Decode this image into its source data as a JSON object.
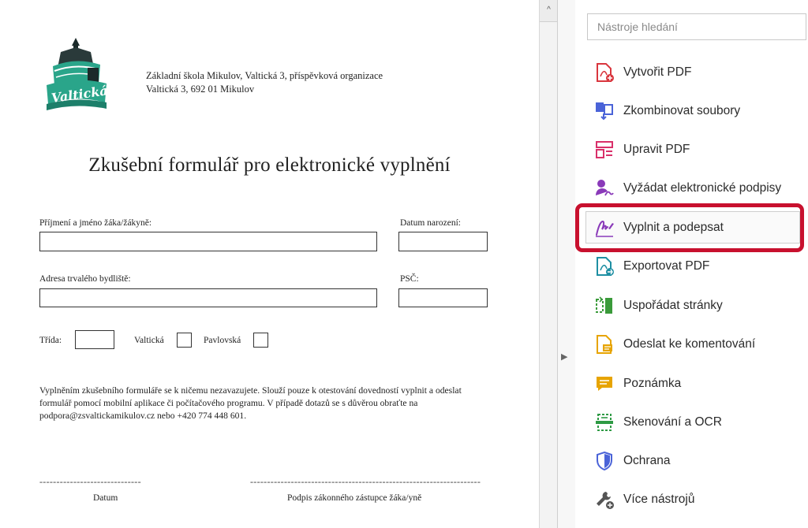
{
  "document": {
    "logo_text": "Valtická",
    "school_line1": "Základní škola Mikulov, Valtická 3, příspěvková organizace",
    "school_line2": "Valtická 3, 692 01 Mikulov",
    "form_title": "Zkušební formulář pro elektronické vyplnění",
    "fields": {
      "name_label": "Příjmení a jméno žáka/žákyně:",
      "birth_label": "Datum narození:",
      "address_label": "Adresa trvalého bydliště:",
      "psc_label": "PSČ:",
      "class_label": "Třída:",
      "valticka_label": "Valtická",
      "pavlovska_label": "Pavlovská"
    },
    "notice": "Vyplněním zkušebního formuláře se k ničemu nezavazujete. Slouží pouze k otestování dovedností vyplnit a odeslat formulář pomocí mobilní aplikace či počítačového programu. V případě dotazů se s důvěrou obraťte na podpora@zsvaltickamikulov.cz nebo +420 774 448 601.",
    "sig_dashes_left": "------------------------------",
    "sig_dashes_right": "--------------------------------------------------------------------",
    "date_label": "Datum",
    "signature_label": "Podpis zákonného zástupce žáka/yně"
  },
  "scrollbar": {
    "up_glyph": "^"
  },
  "divider": {
    "collapse_glyph": "▶"
  },
  "tools": {
    "search_placeholder": "Nástroje hledání",
    "items": [
      {
        "label": "Vytvořit PDF",
        "icon": "create-pdf-icon",
        "color": "#d9363e"
      },
      {
        "label": "Zkombinovat soubory",
        "icon": "combine-files-icon",
        "color": "#4a63d8"
      },
      {
        "label": "Upravit PDF",
        "icon": "edit-pdf-icon",
        "color": "#d9306a"
      },
      {
        "label": "Vyžádat elektronické podpisy",
        "icon": "request-signature-icon",
        "color": "#8a3ab9"
      },
      {
        "label": "Vyplnit a podepsat",
        "icon": "fill-sign-icon",
        "color": "#8a3ab9"
      },
      {
        "label": "Exportovat PDF",
        "icon": "export-pdf-icon",
        "color": "#1e8fa3"
      },
      {
        "label": "Uspořádat stránky",
        "icon": "organize-pages-icon",
        "color": "#3a9a3a"
      },
      {
        "label": "Odeslat ke komentování",
        "icon": "send-comment-icon",
        "color": "#e7a400"
      },
      {
        "label": "Poznámka",
        "icon": "comment-icon",
        "color": "#e7a400"
      },
      {
        "label": "Skenování a OCR",
        "icon": "scan-ocr-icon",
        "color": "#2e9a44"
      },
      {
        "label": "Ochrana",
        "icon": "protect-icon",
        "color": "#4a63d8"
      },
      {
        "label": "Více nástrojů",
        "icon": "more-tools-icon",
        "color": "#555555"
      }
    ],
    "highlight_color": "#c8102e"
  }
}
